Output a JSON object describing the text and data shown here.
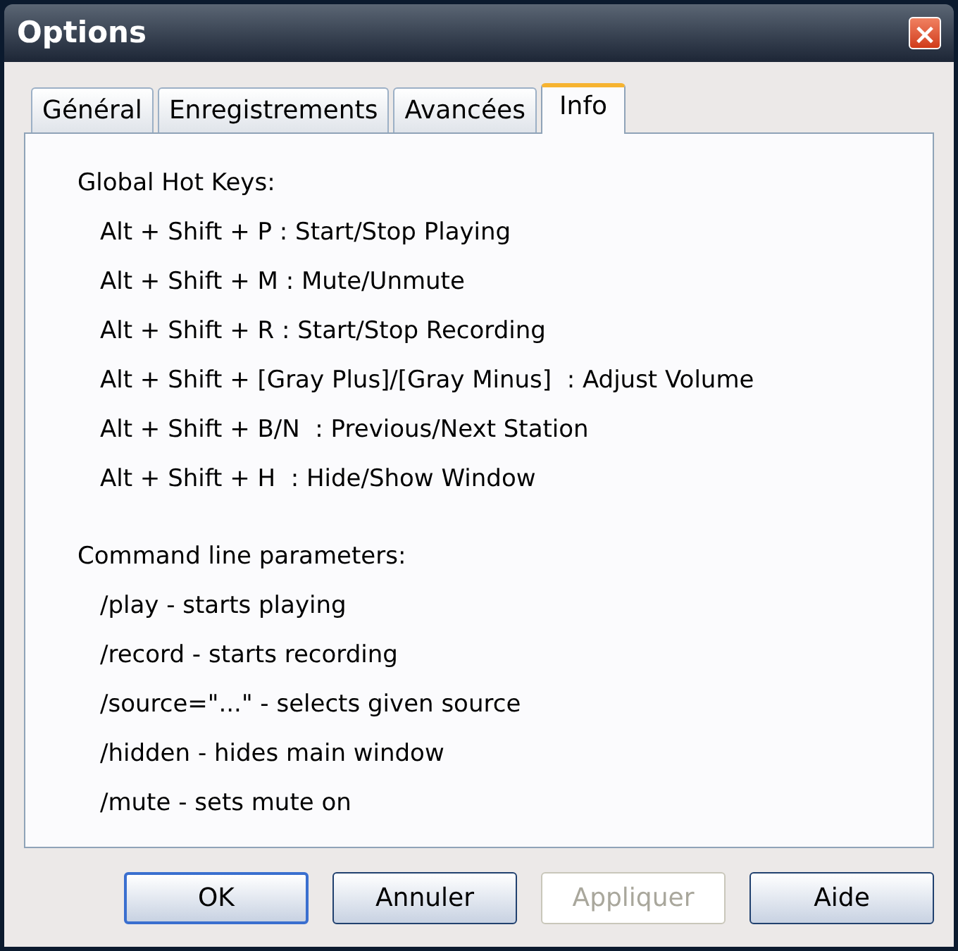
{
  "window": {
    "title": "Options",
    "close": "×"
  },
  "tabs": [
    {
      "label": "Général",
      "selected": false
    },
    {
      "label": "Enregistrements",
      "selected": false
    },
    {
      "label": "Avancées",
      "selected": false
    },
    {
      "label": "Info",
      "selected": true
    }
  ],
  "sections": [
    {
      "heading": "Global Hot Keys:",
      "lines": [
        "Alt + Shift + P : Start/Stop Playing",
        "Alt + Shift + M : Mute/Unmute",
        "Alt + Shift + R : Start/Stop Recording",
        "Alt + Shift + [Gray Plus]/[Gray Minus]  : Adjust Volume",
        "Alt + Shift + B/N  : Previous/Next Station",
        "Alt + Shift + H  : Hide/Show Window"
      ]
    },
    {
      "heading": "Command line parameters:",
      "lines": [
        "/play - starts playing",
        "/record - starts recording",
        "/source=\"...\" - selects given source",
        "/hidden - hides main window",
        "/mute - sets mute on"
      ]
    }
  ],
  "buttons": [
    {
      "label": "OK",
      "default": true,
      "disabled": false
    },
    {
      "label": "Annuler",
      "default": false,
      "disabled": false
    },
    {
      "label": "Appliquer",
      "default": false,
      "disabled": true
    },
    {
      "label": "Aide",
      "default": false,
      "disabled": false
    }
  ]
}
